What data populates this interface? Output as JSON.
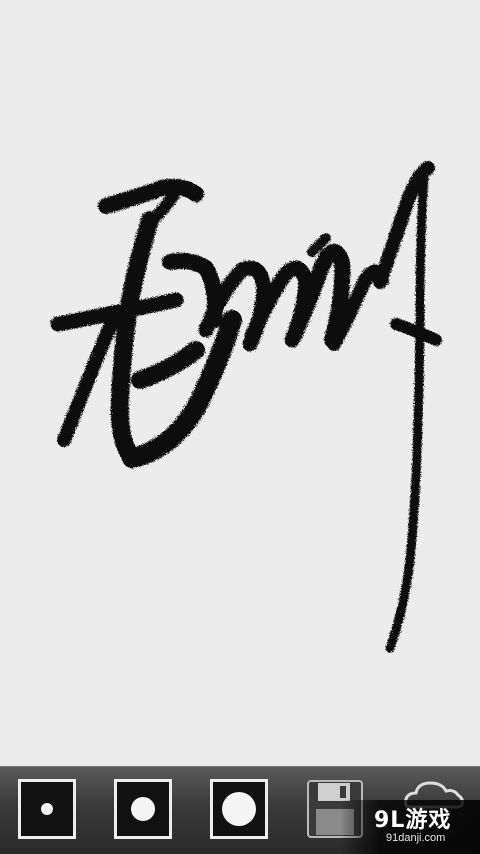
{
  "canvas": {
    "background": "#ececec",
    "ink_color": "#0a0a0a",
    "content": "handwritten-signature"
  },
  "toolbar": {
    "buttons": [
      {
        "name": "brush-small-button",
        "icon": "small-dot-icon"
      },
      {
        "name": "brush-medium-button",
        "icon": "medium-dot-icon"
      },
      {
        "name": "brush-large-button",
        "icon": "large-dot-icon"
      },
      {
        "name": "save-button",
        "icon": "floppy-disk-icon"
      },
      {
        "name": "upload-button",
        "icon": "cloud-icon"
      }
    ]
  },
  "watermark": {
    "logo_text": "9L游戏",
    "url_text": "91danji.com"
  }
}
